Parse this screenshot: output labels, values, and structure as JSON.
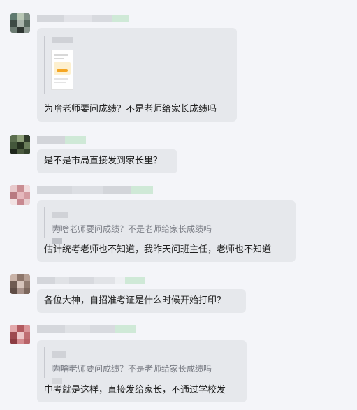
{
  "messages": [
    {
      "text": "为啥老师要问成绩？不是老师给家长成绩吗",
      "attachment": "image-thumbnail"
    },
    {
      "text": "是不是市局直接发到家长里？"
    },
    {
      "quote": "为啥老师要问成绩？不是老师给家长成绩吗",
      "text": "估计统考老师也不知道，我昨天问班主任，老师也不知道"
    },
    {
      "text": "各位大神，自招准考证是什么时候开始打印？"
    },
    {
      "quote": "为啥老师要问成绩？不是老师给家长成绩吗",
      "text": "中考就是这样，直接发给家长，不通过学校发"
    }
  ],
  "icons": {
    "thumbnail": "image-icon"
  }
}
